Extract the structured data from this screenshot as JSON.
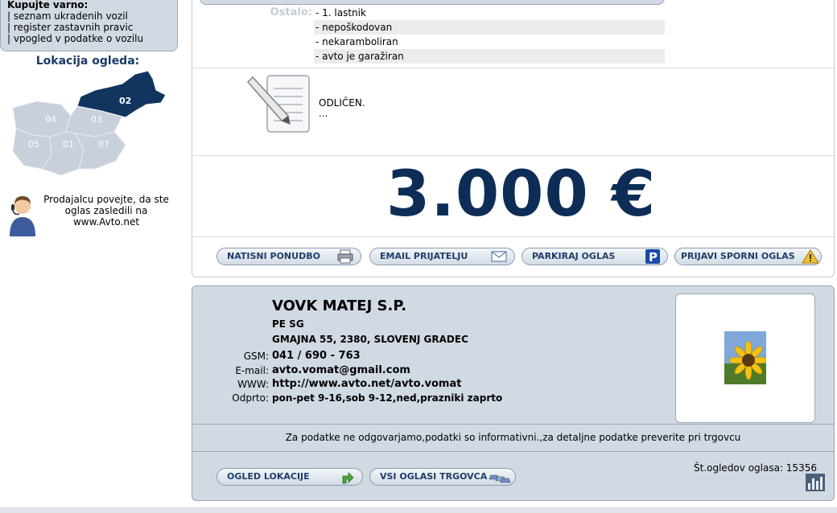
{
  "safe_box": {
    "title": "Kupujte varno:",
    "links": [
      "| seznam ukradenih vozil",
      "| register zastavnih pravic",
      "| vpogled v podatke o vozilu"
    ]
  },
  "location": {
    "title": "Lokacija ogleda:",
    "regions": [
      "02",
      "04",
      "03",
      "05",
      "01",
      "07"
    ],
    "selected": "02"
  },
  "agent": {
    "text": "Prodajalcu povejte, da ste oglas zasledili na www.Avto.net"
  },
  "ostalo": {
    "label": "Ostalo:",
    "items": [
      "- 1. lastnik",
      "- nepoškodovan",
      "- nekaramboliran",
      "- avto je garažiran"
    ]
  },
  "description": {
    "title": "ODLIČEN.",
    "more": "..."
  },
  "price": "3.000 €",
  "actions": {
    "print": "NATISNI PONUDBO",
    "email": "EMAIL PRIJATELJU",
    "park": "PARKIRAJ OGLAS",
    "report": "PRIJAVI SPORNI OGLAS"
  },
  "dealer": {
    "name": "VOVK MATEJ S.P.",
    "branch": "PE SG",
    "address": "GMAJNA 55, 2380, SLOVENJ GRADEC",
    "gsm_label": "GSM:",
    "gsm": "041 / 690 - 763",
    "email_label": "E-mail:",
    "email": "avto.vomat@gmail.com",
    "www_label": "WWW:",
    "www": "http://www.avto.net/avto.vomat",
    "hours_label": "Odprto:",
    "hours": "pon-pet 9-16,sob 9-12,ned,prazniki zaprto",
    "disclaimer": "Za podatke ne odgovarjamo,podatki so informativni.,za detaljne podatke preverite pri trgovcu",
    "location_button": "OGLED LOKACIJE",
    "all_ads_button": "VSI OGLASI TRGOVCA",
    "views": "Št.ogledov oglasa: 15356"
  },
  "colors": {
    "accent": "#0d2d57",
    "panel": "#d1d9e2",
    "map_selected": "#12355f",
    "map_region": "#c7d0db"
  },
  "icons": [
    "printer-icon",
    "envelope-icon",
    "parking-icon",
    "warning-icon",
    "arrow-icon",
    "cars-icon",
    "stats-icon",
    "notepad-icon",
    "agent-icon"
  ]
}
